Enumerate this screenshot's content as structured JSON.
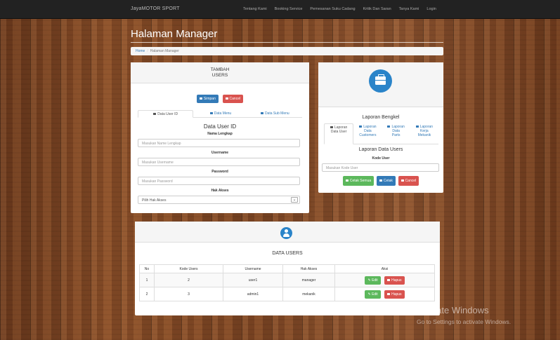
{
  "navbar": {
    "brand": "JayaMOTOR SPORT",
    "links": [
      "Tentang Kami",
      "Booking Service",
      "Pemesanan Suku Cadang",
      "Kritik Dan Saran",
      "Tanya Kami",
      "Login"
    ]
  },
  "page": {
    "title": "Halaman Manager",
    "breadcrumb": {
      "home": "Home",
      "separator": "/",
      "current": "Halaman Manager"
    }
  },
  "add_users_panel": {
    "heading_line1": "TAMBAH",
    "heading_line2": "USERS",
    "save_label": "Simpan",
    "cancel_label": "Cancel",
    "tabs": [
      "Data User ID",
      "Data Menu",
      "Data Sub Menu"
    ],
    "form_title": "Data User ID",
    "fields": {
      "name": {
        "label": "Nama Lengkap",
        "placeholder": "Masukan Name Lengkap"
      },
      "username": {
        "label": "Username",
        "placeholder": "Masukan Username"
      },
      "password": {
        "label": "Password",
        "placeholder": "Masukan Password"
      },
      "role": {
        "label": "Hak Akses",
        "selected": "Pilih Hak Akses"
      }
    }
  },
  "report_panel": {
    "title": "Laporan Bengkel",
    "tabs": [
      {
        "line1": "Laporan",
        "line2": "Data User",
        "line3": ""
      },
      {
        "line1": "Laporan",
        "line2": "Data",
        "line3": "Customers"
      },
      {
        "line1": "Laporan",
        "line2": "Data",
        "line3": "Parts"
      },
      {
        "line1": "Laporan",
        "line2": "Kerja",
        "line3": "Mekanik"
      }
    ],
    "subtitle": "Laporan Data Users",
    "field_label": "Kode User",
    "field_placeholder": "Masukan Kode User",
    "print_all_label": "Cetak Semua",
    "print_label": "Cetak",
    "cancel_label": "Cancel"
  },
  "users_table": {
    "title": "DATA USERS",
    "columns": [
      "No",
      "Kode Users",
      "Username",
      "Hak Akses",
      "Aksi"
    ],
    "rows": [
      {
        "no": "1",
        "kode": "2",
        "username": "user1",
        "role": "manager"
      },
      {
        "no": "2",
        "kode": "3",
        "username": "admin1",
        "role": "mekanik"
      }
    ],
    "edit_label": "Edit",
    "delete_label": "Hapus"
  },
  "watermark": {
    "title": "Activate Windows",
    "subtitle": "Go to Settings to activate Windows."
  },
  "colors": {
    "primary": "#337ab7",
    "danger": "#d9534f",
    "success": "#5cb85c",
    "icon_blue": "#2a84c9",
    "navbar": "#222222"
  }
}
